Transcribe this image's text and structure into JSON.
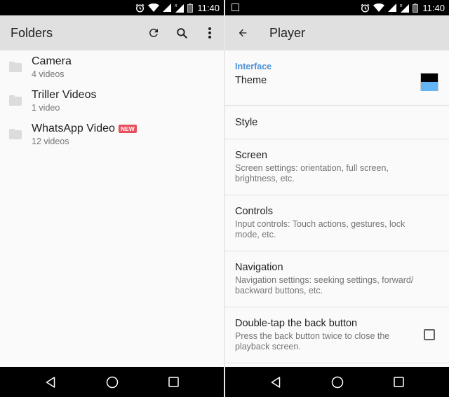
{
  "left_screen": {
    "status_bar": {
      "time": "11:40",
      "icons": [
        "alarm-icon",
        "wifi-icon",
        "signal-icon",
        "roaming-signal-icon",
        "battery-icon"
      ]
    },
    "app_bar": {
      "title": "Folders",
      "actions": [
        "refresh-icon",
        "search-icon",
        "more-vert-icon"
      ]
    },
    "folders": [
      {
        "name": "Camera",
        "count": "4 videos",
        "badge": ""
      },
      {
        "name": "Triller Videos",
        "count": "1 video",
        "badge": ""
      },
      {
        "name": "WhatsApp Video",
        "count": "12 videos",
        "badge": "NEW"
      }
    ],
    "nav_bar": [
      "back-icon",
      "home-icon",
      "recents-icon"
    ]
  },
  "right_screen": {
    "status_bar": {
      "time": "11:40",
      "notification_icon": "image-icon",
      "icons": [
        "alarm-icon",
        "wifi-icon",
        "signal-icon",
        "roaming-signal-icon",
        "battery-icon"
      ]
    },
    "app_bar": {
      "title": "Player",
      "nav_icon": "arrow-back-icon"
    },
    "section_header": "Interface",
    "preferences": {
      "theme": {
        "title": "Theme",
        "swatch_colors": [
          "#000000",
          "#64b5f6"
        ]
      },
      "style": {
        "title": "Style"
      },
      "screen": {
        "title": "Screen",
        "summary": "Screen settings: orientation, full screen, brightness, etc."
      },
      "controls": {
        "title": "Controls",
        "summary": "Input controls: Touch actions, gestures, lock mode, etc."
      },
      "navigation": {
        "title": "Navigation",
        "summary": "Navigation settings: seeking settings, forward/ backward buttons, etc."
      },
      "double_tap": {
        "title": "Double-tap the back button",
        "summary": "Press the back button twice to close the playback screen.",
        "checked": false
      }
    },
    "nav_bar": [
      "back-icon",
      "home-icon",
      "recents-icon"
    ]
  },
  "colors": {
    "accent": "#4a90d9",
    "badge": "#e84f5c",
    "app_bar": "#e0e0e0"
  }
}
